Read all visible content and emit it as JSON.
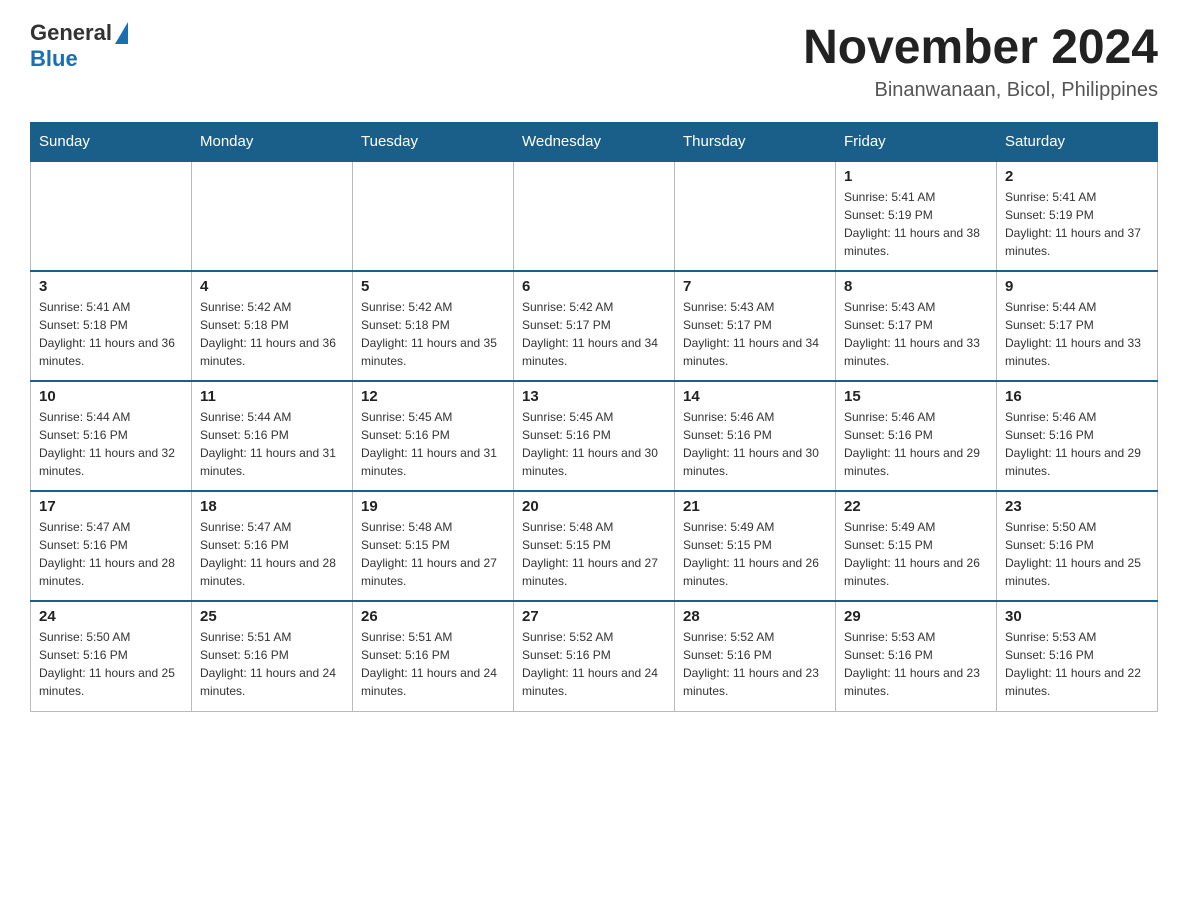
{
  "header": {
    "logo_general": "General",
    "logo_blue": "Blue",
    "title": "November 2024",
    "subtitle": "Binanwanaan, Bicol, Philippines"
  },
  "weekdays": [
    "Sunday",
    "Monday",
    "Tuesday",
    "Wednesday",
    "Thursday",
    "Friday",
    "Saturday"
  ],
  "weeks": [
    [
      {
        "day": "",
        "info": ""
      },
      {
        "day": "",
        "info": ""
      },
      {
        "day": "",
        "info": ""
      },
      {
        "day": "",
        "info": ""
      },
      {
        "day": "",
        "info": ""
      },
      {
        "day": "1",
        "info": "Sunrise: 5:41 AM\nSunset: 5:19 PM\nDaylight: 11 hours and 38 minutes."
      },
      {
        "day": "2",
        "info": "Sunrise: 5:41 AM\nSunset: 5:19 PM\nDaylight: 11 hours and 37 minutes."
      }
    ],
    [
      {
        "day": "3",
        "info": "Sunrise: 5:41 AM\nSunset: 5:18 PM\nDaylight: 11 hours and 36 minutes."
      },
      {
        "day": "4",
        "info": "Sunrise: 5:42 AM\nSunset: 5:18 PM\nDaylight: 11 hours and 36 minutes."
      },
      {
        "day": "5",
        "info": "Sunrise: 5:42 AM\nSunset: 5:18 PM\nDaylight: 11 hours and 35 minutes."
      },
      {
        "day": "6",
        "info": "Sunrise: 5:42 AM\nSunset: 5:17 PM\nDaylight: 11 hours and 34 minutes."
      },
      {
        "day": "7",
        "info": "Sunrise: 5:43 AM\nSunset: 5:17 PM\nDaylight: 11 hours and 34 minutes."
      },
      {
        "day": "8",
        "info": "Sunrise: 5:43 AM\nSunset: 5:17 PM\nDaylight: 11 hours and 33 minutes."
      },
      {
        "day": "9",
        "info": "Sunrise: 5:44 AM\nSunset: 5:17 PM\nDaylight: 11 hours and 33 minutes."
      }
    ],
    [
      {
        "day": "10",
        "info": "Sunrise: 5:44 AM\nSunset: 5:16 PM\nDaylight: 11 hours and 32 minutes."
      },
      {
        "day": "11",
        "info": "Sunrise: 5:44 AM\nSunset: 5:16 PM\nDaylight: 11 hours and 31 minutes."
      },
      {
        "day": "12",
        "info": "Sunrise: 5:45 AM\nSunset: 5:16 PM\nDaylight: 11 hours and 31 minutes."
      },
      {
        "day": "13",
        "info": "Sunrise: 5:45 AM\nSunset: 5:16 PM\nDaylight: 11 hours and 30 minutes."
      },
      {
        "day": "14",
        "info": "Sunrise: 5:46 AM\nSunset: 5:16 PM\nDaylight: 11 hours and 30 minutes."
      },
      {
        "day": "15",
        "info": "Sunrise: 5:46 AM\nSunset: 5:16 PM\nDaylight: 11 hours and 29 minutes."
      },
      {
        "day": "16",
        "info": "Sunrise: 5:46 AM\nSunset: 5:16 PM\nDaylight: 11 hours and 29 minutes."
      }
    ],
    [
      {
        "day": "17",
        "info": "Sunrise: 5:47 AM\nSunset: 5:16 PM\nDaylight: 11 hours and 28 minutes."
      },
      {
        "day": "18",
        "info": "Sunrise: 5:47 AM\nSunset: 5:16 PM\nDaylight: 11 hours and 28 minutes."
      },
      {
        "day": "19",
        "info": "Sunrise: 5:48 AM\nSunset: 5:15 PM\nDaylight: 11 hours and 27 minutes."
      },
      {
        "day": "20",
        "info": "Sunrise: 5:48 AM\nSunset: 5:15 PM\nDaylight: 11 hours and 27 minutes."
      },
      {
        "day": "21",
        "info": "Sunrise: 5:49 AM\nSunset: 5:15 PM\nDaylight: 11 hours and 26 minutes."
      },
      {
        "day": "22",
        "info": "Sunrise: 5:49 AM\nSunset: 5:15 PM\nDaylight: 11 hours and 26 minutes."
      },
      {
        "day": "23",
        "info": "Sunrise: 5:50 AM\nSunset: 5:16 PM\nDaylight: 11 hours and 25 minutes."
      }
    ],
    [
      {
        "day": "24",
        "info": "Sunrise: 5:50 AM\nSunset: 5:16 PM\nDaylight: 11 hours and 25 minutes."
      },
      {
        "day": "25",
        "info": "Sunrise: 5:51 AM\nSunset: 5:16 PM\nDaylight: 11 hours and 24 minutes."
      },
      {
        "day": "26",
        "info": "Sunrise: 5:51 AM\nSunset: 5:16 PM\nDaylight: 11 hours and 24 minutes."
      },
      {
        "day": "27",
        "info": "Sunrise: 5:52 AM\nSunset: 5:16 PM\nDaylight: 11 hours and 24 minutes."
      },
      {
        "day": "28",
        "info": "Sunrise: 5:52 AM\nSunset: 5:16 PM\nDaylight: 11 hours and 23 minutes."
      },
      {
        "day": "29",
        "info": "Sunrise: 5:53 AM\nSunset: 5:16 PM\nDaylight: 11 hours and 23 minutes."
      },
      {
        "day": "30",
        "info": "Sunrise: 5:53 AM\nSunset: 5:16 PM\nDaylight: 11 hours and 22 minutes."
      }
    ]
  ]
}
